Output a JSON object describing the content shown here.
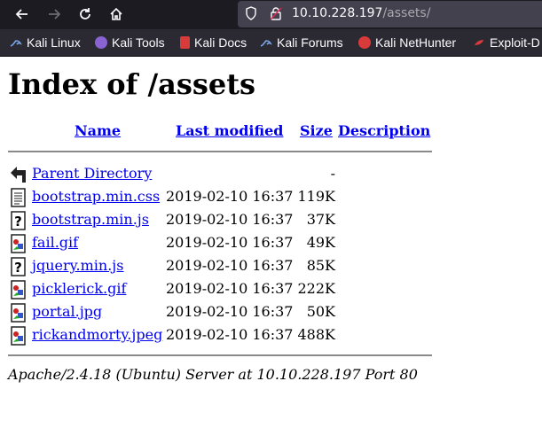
{
  "browser": {
    "url_host": "10.10.228.197",
    "url_path": "/assets/",
    "bookmarks": [
      {
        "label": "Kali Linux",
        "color": "#5a8fd8"
      },
      {
        "label": "Kali Tools",
        "color": "#8a63d2"
      },
      {
        "label": "Kali Docs",
        "color": "#d93b3b"
      },
      {
        "label": "Kali Forums",
        "color": "#5a8fd8"
      },
      {
        "label": "Kali NetHunter",
        "color": "#d93b3b"
      },
      {
        "label": "Exploit-D",
        "color": "#d93b3b"
      }
    ]
  },
  "page": {
    "title": "Index of /assets",
    "columns": {
      "name": "Name",
      "modified": "Last modified",
      "size": "Size",
      "description": "Description"
    },
    "parent": {
      "name": "Parent Directory",
      "size": "-"
    },
    "files": [
      {
        "name": "bootstrap.min.css",
        "modified": "2019-02-10 16:37",
        "size": "119K",
        "icon": "text-file-icon"
      },
      {
        "name": "bootstrap.min.js",
        "modified": "2019-02-10 16:37",
        "size": "37K",
        "icon": "unknown-file-icon"
      },
      {
        "name": "fail.gif",
        "modified": "2019-02-10 16:37",
        "size": "49K",
        "icon": "image-file-icon"
      },
      {
        "name": "jquery.min.js",
        "modified": "2019-02-10 16:37",
        "size": "85K",
        "icon": "unknown-file-icon"
      },
      {
        "name": "picklerick.gif",
        "modified": "2019-02-10 16:37",
        "size": "222K",
        "icon": "image-file-icon"
      },
      {
        "name": "portal.jpg",
        "modified": "2019-02-10 16:37",
        "size": "50K",
        "icon": "image-file-icon"
      },
      {
        "name": "rickandmorty.jpeg",
        "modified": "2019-02-10 16:37",
        "size": "488K",
        "icon": "image-file-icon"
      }
    ],
    "footer": "Apache/2.4.18 (Ubuntu) Server at 10.10.228.197 Port 80"
  }
}
